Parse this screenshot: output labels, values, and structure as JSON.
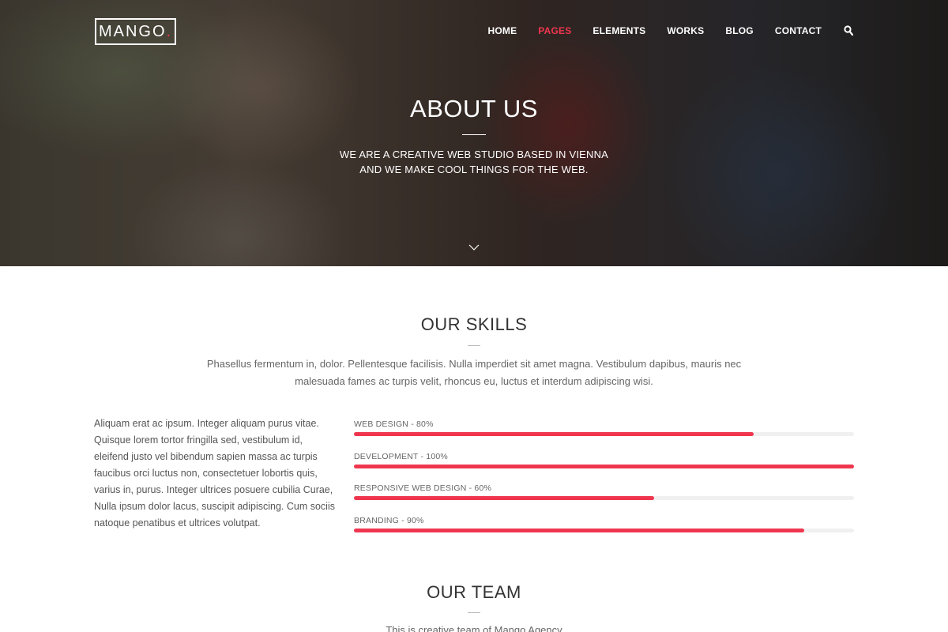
{
  "brand": {
    "name": "MANGO",
    "dot": ".",
    "accent": "#f0364f"
  },
  "nav": {
    "items": [
      {
        "label": "HOME",
        "active": false
      },
      {
        "label": "PAGES",
        "active": true
      },
      {
        "label": "ELEMENTS",
        "active": false
      },
      {
        "label": "WORKS",
        "active": false
      },
      {
        "label": "BLOG",
        "active": false
      },
      {
        "label": "CONTACT",
        "active": false
      }
    ],
    "search_icon": "search-icon"
  },
  "hero": {
    "title": "ABOUT US",
    "subtitle_line1": "WE ARE A CREATIVE WEB STUDIO BASED IN VIENNA",
    "subtitle_line2": "AND WE MAKE COOL THINGS FOR THE WEB.",
    "scroll_icon": "chevron-down-icon"
  },
  "skills": {
    "title": "OUR SKILLS",
    "intro": "Phasellus fermentum in, dolor. Pellentesque facilisis. Nulla imperdiet sit amet magna. Vestibulum dapibus, mauris nec malesuada fames ac turpis velit, rhoncus eu, luctus et interdum adipiscing wisi.",
    "left_text": "Aliquam erat ac ipsum. Integer aliquam purus vitae. Quisque lorem tortor fringilla sed, vestibulum id, eleifend justo vel bibendum sapien massa ac turpis faucibus orci luctus non, consectetuer lobortis quis, varius in, purus. Integer ultrices posuere cubilia Curae, Nulla ipsum dolor lacus, suscipit adipiscing. Cum sociis natoque penatibus et ultrices volutpat.",
    "bars": [
      {
        "label": "WEB DESIGN - 80%",
        "percent": 80
      },
      {
        "label": "DEVELOPMENT - 100%",
        "percent": 100
      },
      {
        "label": "RESPONSIVE WEB DESIGN - 60%",
        "percent": 60
      },
      {
        "label": "BRANDING - 90%",
        "percent": 90
      }
    ]
  },
  "team": {
    "title": "OUR TEAM",
    "subtitle": "This is creative team of Mango Agency"
  }
}
